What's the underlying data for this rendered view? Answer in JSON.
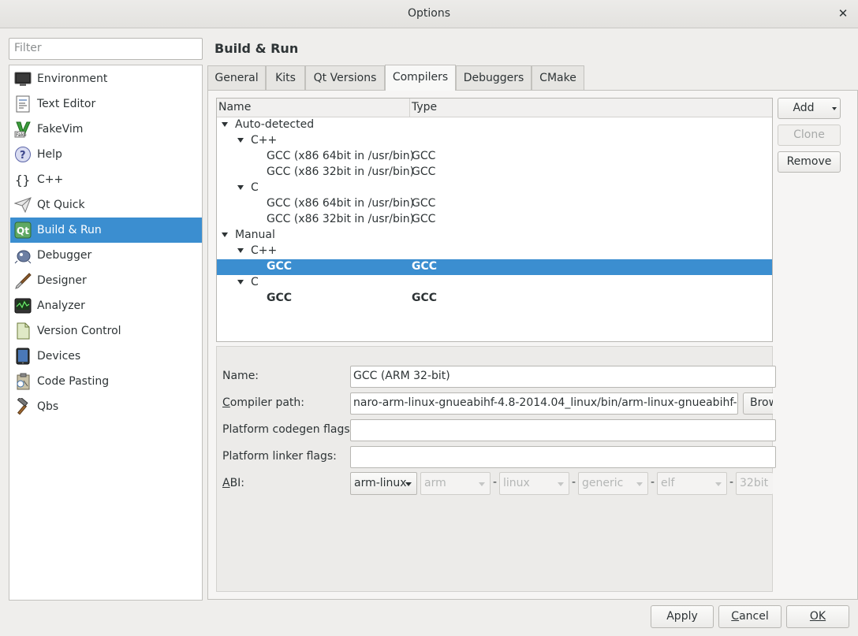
{
  "window": {
    "title": "Options",
    "close_glyph": "✕"
  },
  "filter": {
    "placeholder": "Filter"
  },
  "categories": [
    {
      "label": "Environment",
      "icon": "monitor-icon"
    },
    {
      "label": "Text Editor",
      "icon": "text-document-icon"
    },
    {
      "label": "FakeVim",
      "icon": "fakevim-icon"
    },
    {
      "label": "Help",
      "icon": "help-icon"
    },
    {
      "label": "C++",
      "icon": "braces-icon"
    },
    {
      "label": "Qt Quick",
      "icon": "paper-plane-icon"
    },
    {
      "label": "Build & Run",
      "icon": "qt-build-icon",
      "selected": true
    },
    {
      "label": "Debugger",
      "icon": "bug-icon"
    },
    {
      "label": "Designer",
      "icon": "brush-icon"
    },
    {
      "label": "Analyzer",
      "icon": "oscilloscope-icon"
    },
    {
      "label": "Version Control",
      "icon": "document-vc-icon"
    },
    {
      "label": "Devices",
      "icon": "tablet-icon"
    },
    {
      "label": "Code Pasting",
      "icon": "clipboard-icon"
    },
    {
      "label": "Qbs",
      "icon": "hammer-icon"
    }
  ],
  "page": {
    "heading": "Build & Run"
  },
  "tabs": [
    {
      "label": "General"
    },
    {
      "label": "Kits"
    },
    {
      "label": "Qt Versions"
    },
    {
      "label": "Compilers",
      "active": true
    },
    {
      "label": "Debuggers"
    },
    {
      "label": "CMake"
    }
  ],
  "tree": {
    "columns": {
      "name": "Name",
      "type": "Type"
    },
    "rows": [
      {
        "name": "Auto-detected",
        "type": "",
        "depth": 0,
        "expanded": true
      },
      {
        "name": "C++",
        "type": "",
        "depth": 1,
        "expanded": true
      },
      {
        "name": "GCC (x86 64bit in /usr/bin)",
        "type": "GCC",
        "depth": 2
      },
      {
        "name": "GCC (x86 32bit in /usr/bin)",
        "type": "GCC",
        "depth": 2
      },
      {
        "name": "C",
        "type": "",
        "depth": 1,
        "expanded": true
      },
      {
        "name": "GCC (x86 64bit in /usr/bin)",
        "type": "GCC",
        "depth": 2
      },
      {
        "name": "GCC (x86 32bit in /usr/bin)",
        "type": "GCC",
        "depth": 2
      },
      {
        "name": "Manual",
        "type": "",
        "depth": 0,
        "expanded": true
      },
      {
        "name": "C++",
        "type": "",
        "depth": 1,
        "expanded": true
      },
      {
        "name": "GCC",
        "type": "GCC",
        "depth": 2,
        "selected": true,
        "bold": true
      },
      {
        "name": "C",
        "type": "",
        "depth": 1,
        "expanded": true
      },
      {
        "name": "GCC",
        "type": "GCC",
        "depth": 2,
        "bold": true
      }
    ]
  },
  "actions": {
    "add": "Add",
    "clone": "Clone",
    "remove": "Remove"
  },
  "details": {
    "name_label": "Name:",
    "name_value": "GCC (ARM 32-bit)",
    "compiler_path_label_mnemonic": "C",
    "compiler_path_label_rest": "ompiler path:",
    "compiler_path_value": "naro-arm-linux-gnueabihf-4.8-2014.04_linux/bin/arm-linux-gnueabihf-g++",
    "browse_label": "Browse...",
    "codegen_label": "Platform codegen flags:",
    "codegen_value": "",
    "linker_label": "Platform linker flags:",
    "linker_value": "",
    "abi_label_mnemonic": "A",
    "abi_label_rest": "BI:",
    "abi": {
      "preset": "arm-linux",
      "architecture": "arm",
      "os": "linux",
      "flavor": "generic",
      "format": "elf",
      "width": "32bit",
      "separator": "-"
    }
  },
  "dialog_buttons": {
    "apply": "Apply",
    "cancel": "Cancel",
    "ok": "OK"
  }
}
